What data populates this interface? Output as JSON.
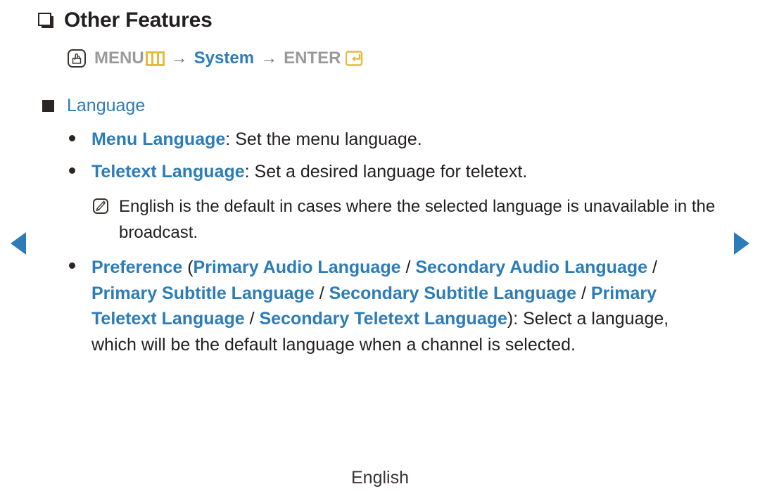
{
  "page": {
    "heading": "Other Features",
    "heading_icon": "hollow-square-icon",
    "footer_label": "English",
    "accent_blue": "#2c7cba",
    "accent_gold": "#e3bb3f",
    "text_dark": "#231f20",
    "text_grey": "#9a9a9a"
  },
  "navigation": {
    "prev_label": "◀",
    "next_label": "▶"
  },
  "breadcrumb": {
    "remote_icon": "hand-press-button-icon",
    "step1": "MENU",
    "menu_icon": "menu-bars-icon",
    "arrow1": "→",
    "step2": "System",
    "arrow2": "→",
    "step3": "ENTER",
    "enter_icon": "enter-return-icon"
  },
  "section": {
    "bullet_icon": "filled-square-icon",
    "title": "Language"
  },
  "items": [
    {
      "term": "Menu Language",
      "separator": ": ",
      "description": "Set the menu language."
    },
    {
      "term": "Teletext Language",
      "separator": ": ",
      "description": "Set a desired language for teletext."
    }
  ],
  "note": {
    "icon": "note-pencil-icon",
    "text": "English is the default in cases where the selected language is unavailable in the broadcast."
  },
  "preference": {
    "term": "Preference",
    "open_paren": " (",
    "options": [
      "Primary Audio Language",
      "Secondary Audio Language",
      "Primary Subtitle Language",
      "Secondary Subtitle Language",
      "Primary Teletext Language",
      "Secondary Teletext Language"
    ],
    "option_separator": " / ",
    "close_paren": ")",
    "description": ": Select a language, which will be the default language when a channel is selected."
  }
}
